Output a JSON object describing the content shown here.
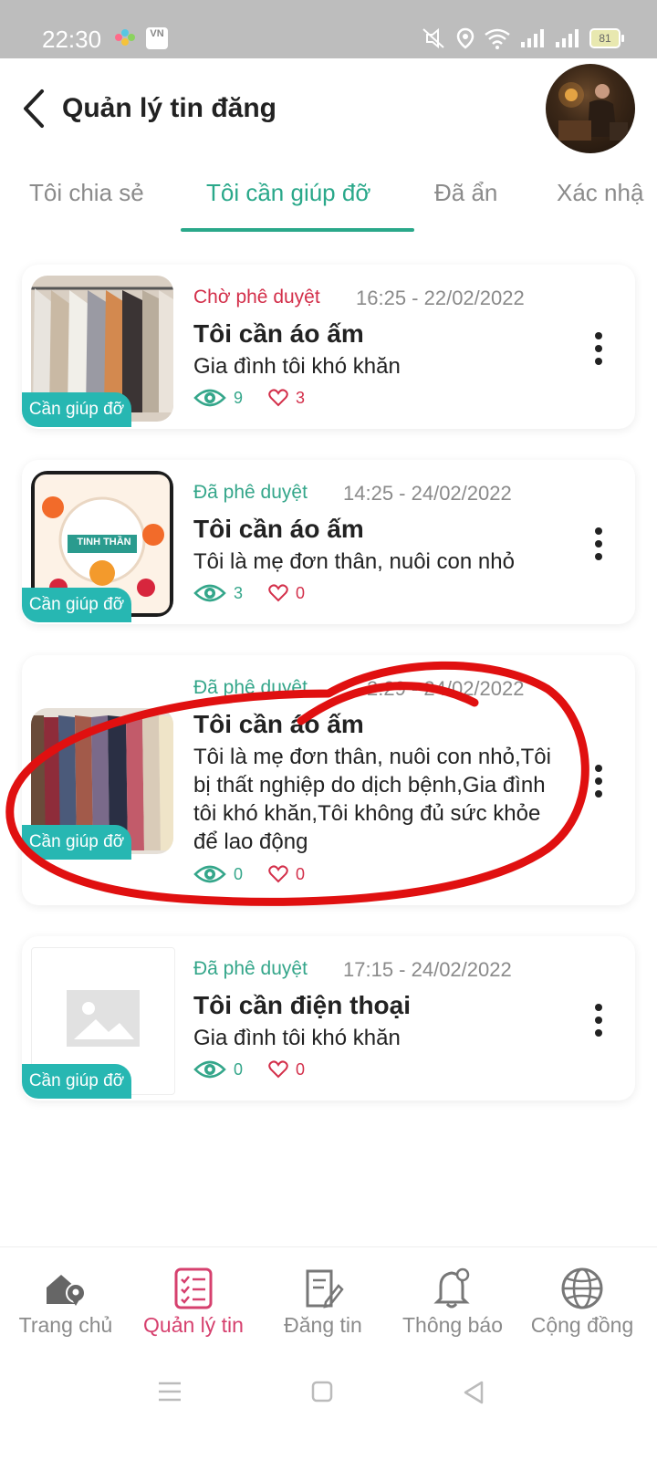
{
  "status_bar": {
    "time": "22:30",
    "battery": "81"
  },
  "header": {
    "title": "Quản lý tin đăng"
  },
  "tabs": [
    {
      "label": "Tôi chia sẻ"
    },
    {
      "label": "Tôi cần giúp đỡ"
    },
    {
      "label": "Đã ẩn"
    },
    {
      "label": "Xác nhậ"
    }
  ],
  "posts": [
    {
      "badge": "Cần giúp đỡ",
      "status": "Chờ phê duyệt",
      "datetime": "16:25 - 22/02/2022",
      "title": "Tôi cần áo ấm",
      "description": "Gia đình tôi khó khăn",
      "views": "9",
      "likes": "3"
    },
    {
      "badge": "Cần giúp đỡ",
      "status": "Đã phê duyệt",
      "datetime": "14:25 - 24/02/2022",
      "title": "Tôi cần áo ấm",
      "description": "Tôi là mẹ đơn thân, nuôi con nhỏ",
      "views": "3",
      "likes": "0",
      "thumb_text": "GẮN KẾT TINH THẦN"
    },
    {
      "badge": "Cần giúp đỡ",
      "status": "Đã phê duyệt",
      "datetime": "2:29 - 24/02/2022",
      "title": "Tôi cần áo ấm",
      "description": "Tôi là mẹ đơn thân, nuôi con nhỏ,Tôi bị thất nghiệp do dịch bệnh,Gia đình tôi khó khăn,Tôi không đủ sức khỏe để lao động",
      "views": "0",
      "likes": "0"
    },
    {
      "badge": "Cần giúp đỡ",
      "status": "Đã phê duyệt",
      "datetime": "17:15 - 24/02/2022",
      "title": "Tôi cần điện thoại",
      "description": "Gia đình tôi khó khăn",
      "views": "0",
      "likes": "0"
    }
  ],
  "bottom_nav": [
    {
      "label": "Trang chủ",
      "icon": "home-location-icon"
    },
    {
      "label": "Quản lý tin",
      "icon": "checklist-icon"
    },
    {
      "label": "Đăng tin",
      "icon": "edit-document-icon"
    },
    {
      "label": "Thông báo",
      "icon": "bell-icon"
    },
    {
      "label": "Cộng đồng",
      "icon": "globe-icon"
    }
  ],
  "colors": {
    "accent": "#2aa88a",
    "pending": "#d32f4a",
    "badge": "#27b7b2",
    "nav_active": "#d6406e",
    "annotation": "#e01010"
  }
}
